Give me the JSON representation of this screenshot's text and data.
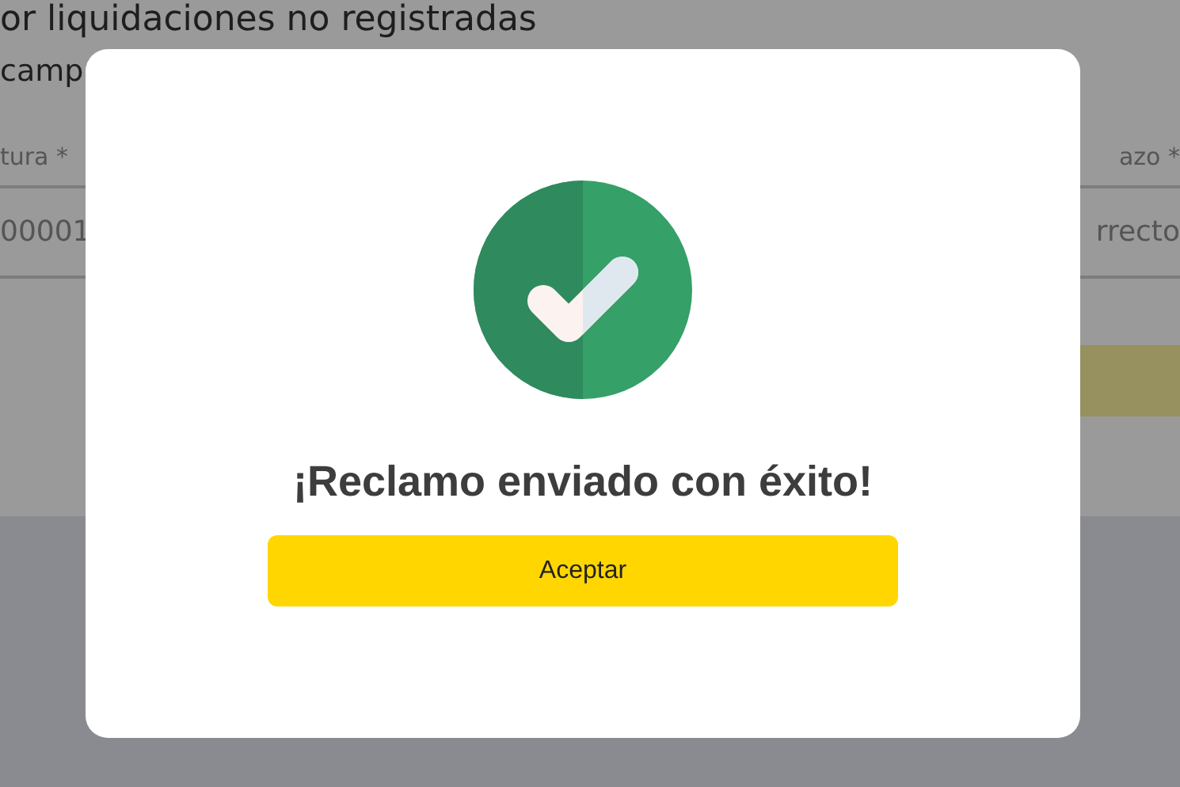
{
  "page": {
    "heading": "or liquidaciones no registradas",
    "note": "camp",
    "fields": [
      {
        "label": "tura *",
        "value": "00001"
      },
      {
        "label": "azo *",
        "value": "rrecto"
      }
    ]
  },
  "dialog": {
    "title": "¡Reclamo enviado con éxito!",
    "button": "Aceptar"
  }
}
